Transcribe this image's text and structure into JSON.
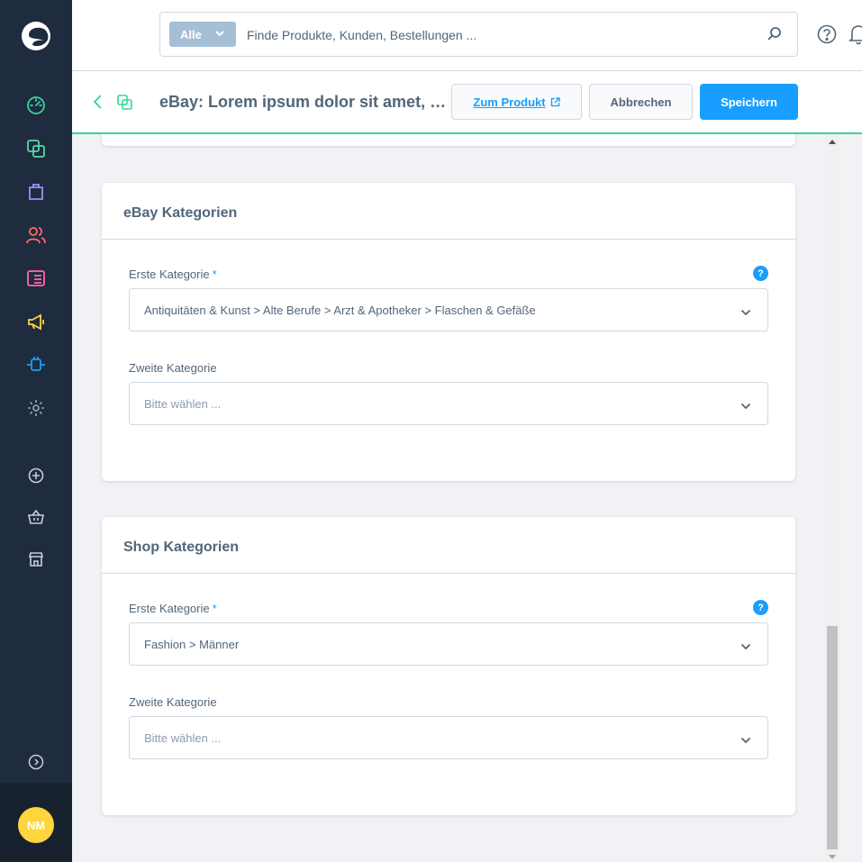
{
  "colors": {
    "sidebar": "#1f2b3e",
    "accent": "#189eff",
    "success": "#37d596",
    "avatar": "#ffd53d"
  },
  "sidebar": {
    "items": [
      {
        "icon": "dashboard-icon",
        "color": "#37d596"
      },
      {
        "icon": "catalog-icon",
        "color": "#57d9a3"
      },
      {
        "icon": "orders-icon",
        "color": "#a092f0"
      },
      {
        "icon": "customers-icon",
        "color": "#ff6b6b"
      },
      {
        "icon": "content-icon",
        "color": "#ff68b4"
      },
      {
        "icon": "marketing-icon",
        "color": "#ffd53d"
      },
      {
        "icon": "extensions-icon",
        "color": "#189eff"
      },
      {
        "icon": "settings-icon",
        "color": "#9aa8b5"
      },
      {
        "icon": "add-icon",
        "color": "#9aa8b5"
      },
      {
        "icon": "basket-icon",
        "color": "#9aa8b5"
      },
      {
        "icon": "storefront-icon",
        "color": "#9aa8b5"
      }
    ],
    "user_initials": "NM"
  },
  "search": {
    "type_label": "Alle",
    "placeholder": "Finde Produkte, Kunden, Bestellungen ..."
  },
  "smartbar": {
    "title": "eBay: Lorem ipsum dolor sit amet, consectetur",
    "link_label": "Zum Produkt",
    "cancel_label": "Abbrechen",
    "save_label": "Speichern"
  },
  "ebay_card": {
    "title": "eBay Kategorien",
    "first_label": "Erste Kategorie",
    "required_mark": "*",
    "help_glyph": "?",
    "first_value": "Antiquitäten & Kunst > Alte Berufe > Arzt & Apotheker > Flaschen & Gefäße",
    "second_label": "Zweite Kategorie",
    "second_placeholder": "Bitte wählen ..."
  },
  "shop_card": {
    "title": "Shop Kategorien",
    "first_label": "Erste Kategorie",
    "required_mark": "*",
    "help_glyph": "?",
    "first_value": "Fashion > Männer",
    "second_label": "Zweite Kategorie",
    "second_placeholder": "Bitte wählen ..."
  }
}
